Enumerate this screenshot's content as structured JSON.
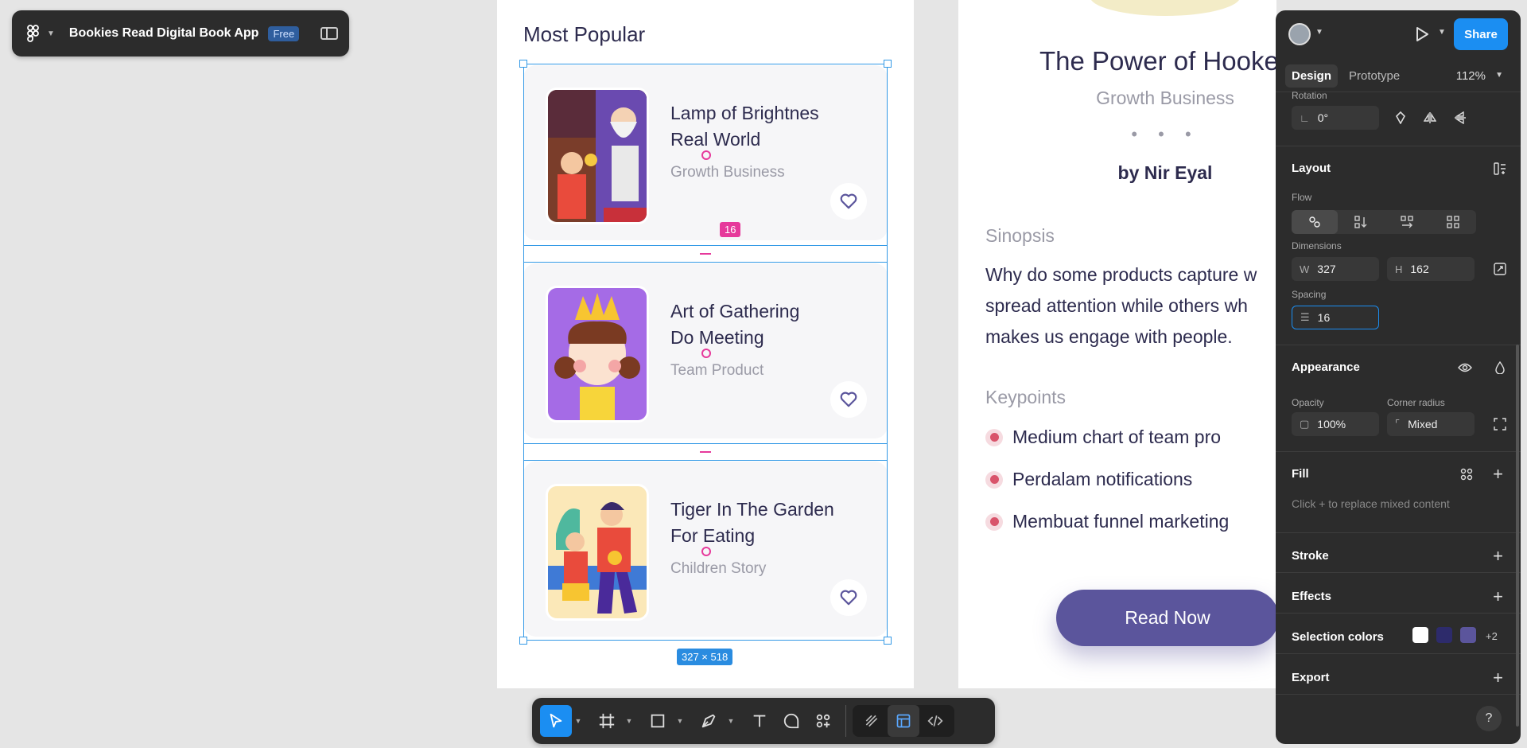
{
  "file": {
    "name": "Bookies Read Digital Book App",
    "plan_badge": "Free"
  },
  "canvas": {
    "section_title": "Most Popular",
    "books": [
      {
        "title_line1": "Lamp of Brightnes",
        "title_line2": "Real World",
        "genre": "Growth Business"
      },
      {
        "title_line1": "Art of Gathering",
        "title_line2": "Do Meeting",
        "genre": "Team Product"
      },
      {
        "title_line1": "Tiger In The Garden",
        "title_line2": "For Eating",
        "genre": "Children Story"
      }
    ],
    "spacing_badge": "16",
    "size_badge": "327 × 518",
    "detail": {
      "title": "The Power of Hooked",
      "subtitle": "Growth Business",
      "dots": "• • •",
      "author": "by Nir Eyal",
      "synopsis_heading": "Sinopsis",
      "synopsis_lines": [
        "Why do some products capture w",
        "spread attention while others wh",
        "makes us engage with people."
      ],
      "keypoints_heading": "Keypoints",
      "keypoints": [
        "Medium chart of team pro",
        "Perdalam notifications",
        "Membuat funnel marketing"
      ],
      "cta": "Read Now"
    }
  },
  "toolbar": {
    "tools": [
      "move-tool",
      "frame-tool",
      "shape-tool",
      "pen-tool",
      "text-tool",
      "comment-tool",
      "actions-tool",
      "draw-mode",
      "design-mode",
      "dev-mode"
    ]
  },
  "panel": {
    "share_label": "Share",
    "tabs": [
      "Design",
      "Prototype"
    ],
    "zoom": "112%",
    "rotation_label": "Rotation",
    "rotation_value": "0°",
    "layout_header": "Layout",
    "flow_label": "Flow",
    "dimensions_label": "Dimensions",
    "width_prefix": "W",
    "width_value": "327",
    "height_prefix": "H",
    "height_value": "162",
    "spacing_label": "Spacing",
    "spacing_value": "16",
    "appearance_header": "Appearance",
    "opacity_label": "Opacity",
    "opacity_value": "100%",
    "corner_label": "Corner radius",
    "corner_value": "Mixed",
    "fill_header": "Fill",
    "fill_note": "Click + to replace mixed content",
    "stroke_header": "Stroke",
    "effects_header": "Effects",
    "selection_colors_header": "Selection colors",
    "selection_colors": [
      "#ffffff",
      "#2d2b6b",
      "#5b559c"
    ],
    "selection_colors_more": "+2",
    "export_header": "Export",
    "help_label": "?"
  }
}
